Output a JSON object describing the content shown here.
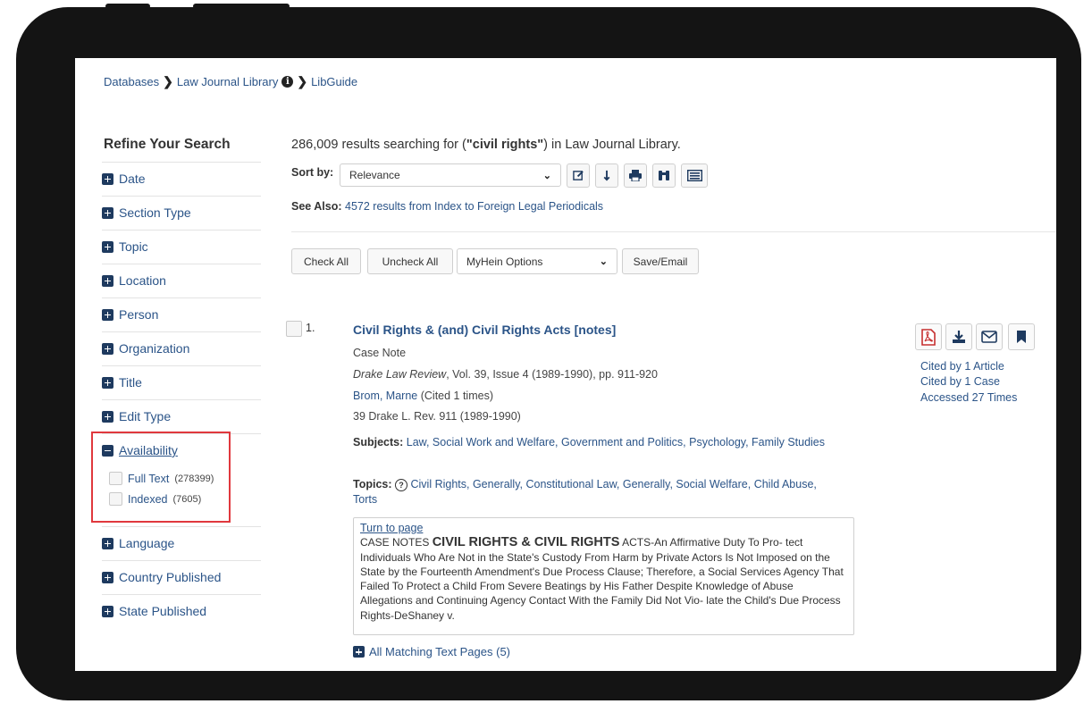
{
  "breadcrumb": {
    "items": [
      "Databases",
      "Law Journal Library",
      "LibGuide"
    ]
  },
  "sidebar": {
    "title": "Refine Your Search",
    "facets": {
      "date": "Date",
      "section_type": "Section Type",
      "topic": "Topic",
      "location": "Location",
      "person": "Person",
      "organization": "Organization",
      "title": "Title",
      "edit_type": "Edit Type",
      "availability": "Availability",
      "language": "Language",
      "country_published": "Country Published",
      "state_published": "State Published"
    },
    "availability_options": [
      {
        "label": "Full Text",
        "count": "(278399)"
      },
      {
        "label": "Indexed",
        "count": "(7605)"
      }
    ],
    "highlight_color": "#e0383d"
  },
  "results": {
    "count": "286,009",
    "text_mid": " results searching for (",
    "query": "\"civil rights\"",
    "text_end": ") in Law Journal Library."
  },
  "sort": {
    "label": "Sort by:",
    "value": "Relevance"
  },
  "toolbar_icons": [
    "edit-icon",
    "sort-direction-icon",
    "print-icon",
    "binoculars-icon",
    "list-view-icon"
  ],
  "see_also": {
    "label": "See Also:",
    "text": "4572 results from Index to Foreign Legal Periodicals"
  },
  "actions": {
    "check_all": "Check All",
    "uncheck_all": "Uncheck All",
    "myhein": "MyHein Options",
    "save_email": "Save/Email"
  },
  "result1": {
    "number": "1.",
    "title": "Civil Rights & (and) Civil Rights Acts [notes]",
    "type": "Case Note",
    "journal": "Drake Law Review",
    "journal_rest": ", Vol. 39, Issue 4 (1989-1990), pp. 911-920",
    "author": "Brom, Marne",
    "author_cited": " (Cited 1 times)",
    "citation": "39 Drake L. Rev. 911 (1989-1990)",
    "subjects_label": "Subjects:",
    "subjects": "Law, Social Work and Welfare, Government and Politics, Psychology, Family Studies",
    "topics_label": "Topics:",
    "topics": "Civil Rights, Generally, Constitutional Law, Generally, Social Welfare, Child Abuse, Torts",
    "snippet_link": "Turn to page",
    "snippet_pre": "CASE NOTES ",
    "snippet_big": "CIVIL RIGHTS & CIVIL RIGHTS",
    "snippet_rest": " ACTS-An Affirmative Duty To Pro- tect Individuals Who Are Not in the State's Custody From Harm by Private Actors Is Not Imposed on the State by the Fourteenth Amendment's Due Process Clause; Therefore, a Social Services Agency That Failed To Protect a Child From Severe Beatings by His Father Despite Knowledge of Abuse Allegations and Continuing Agency Contact With the Family Did Not Vio- late the Child's Due Process Rights-DeShaney v.",
    "all_matching": "All Matching Text Pages (5)",
    "cited_article": "Cited by 1 Article",
    "cited_case": "Cited by 1 Case",
    "accessed": "Accessed 27 Times",
    "action_icons": [
      "pdf-icon",
      "download-icon",
      "email-icon",
      "bookmark-icon"
    ]
  },
  "colors": {
    "link": "#2b5488",
    "icon_dark": "#1e3a5f",
    "pdf_red": "#c62f2f",
    "bezel": "#141414"
  }
}
